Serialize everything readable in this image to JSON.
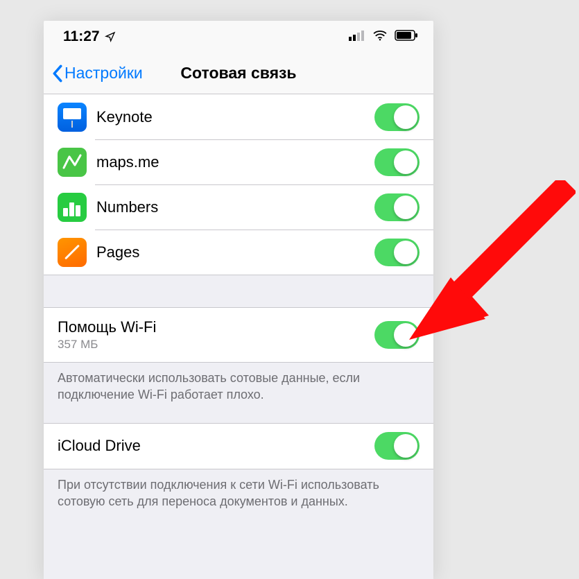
{
  "status": {
    "time": "11:27"
  },
  "nav": {
    "back_label": "Настройки",
    "title": "Сотовая связь"
  },
  "apps": [
    {
      "id": "keynote",
      "label": "Keynote",
      "icon": "keynote-icon",
      "on": true
    },
    {
      "id": "mapsme",
      "label": "maps.me",
      "icon": "mapsme-icon",
      "on": true
    },
    {
      "id": "numbers",
      "label": "Numbers",
      "icon": "numbers-icon",
      "on": true
    },
    {
      "id": "pages",
      "label": "Pages",
      "icon": "pages-icon",
      "on": true
    }
  ],
  "wifi_assist": {
    "label": "Помощь Wi-Fi",
    "usage": "357 МБ",
    "on": true,
    "footer": "Автоматически использовать сотовые данные, если подключение Wi-Fi работает плохо."
  },
  "icloud_drive": {
    "label": "iCloud Drive",
    "on": true,
    "footer": "При отсутствии подключения к сети Wi-Fi использовать сотовую сеть для переноса документов и данных."
  }
}
